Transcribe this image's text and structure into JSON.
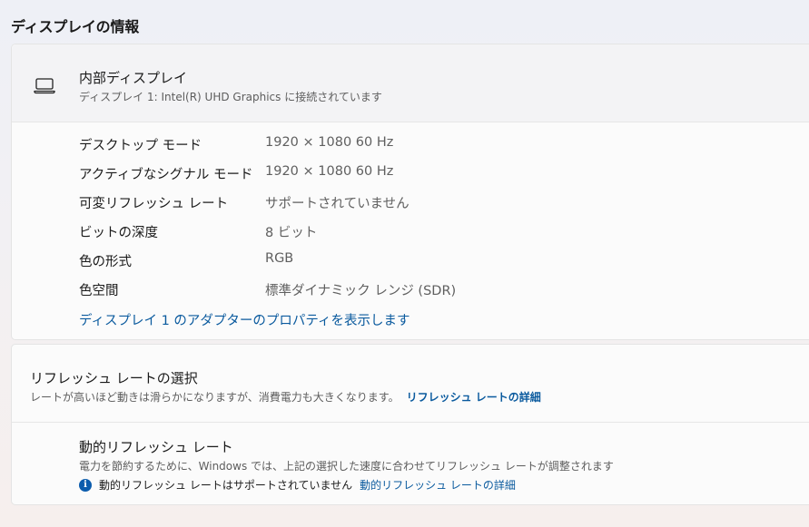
{
  "page": {
    "section_title": "ディスプレイの情報"
  },
  "display": {
    "icon": "laptop-icon",
    "title": "内部ディスプレイ",
    "subtitle": "ディスプレイ 1: Intel(R) UHD Graphics に接続されています",
    "rows": [
      {
        "label": "デスクトップ モード",
        "value": "1920 × 1080 60 Hz"
      },
      {
        "label": "アクティブなシグナル モード",
        "value": "1920 × 1080 60 Hz"
      },
      {
        "label": "可変リフレッシュ レート",
        "value": "サポートされていません"
      },
      {
        "label": "ビットの深度",
        "value": "8 ビット"
      },
      {
        "label": "色の形式",
        "value": "RGB"
      },
      {
        "label": "色空間",
        "value": "標準ダイナミック レンジ (SDR)"
      }
    ],
    "adapter_link": "ディスプレイ 1 のアダプターのプロパティを表示します"
  },
  "refresh": {
    "title": "リフレッシュ レートの選択",
    "description": "レートが高いほど動きは滑らかになりますが、消費電力も大きくなります。",
    "description_link": "リフレッシュ レートの詳細",
    "dynamic": {
      "title": "動的リフレッシュ レート",
      "description": "電力を節約するために、Windows では、上記の選択した速度に合わせてリフレッシュ レートが調整されます",
      "note_icon": "info-icon",
      "note": "動的リフレッシュ レートはサポートされていません",
      "note_link": "動的リフレッシュ レートの詳細"
    }
  },
  "colors": {
    "link": "#0a5a9e",
    "info_icon": "#0b5cad"
  }
}
